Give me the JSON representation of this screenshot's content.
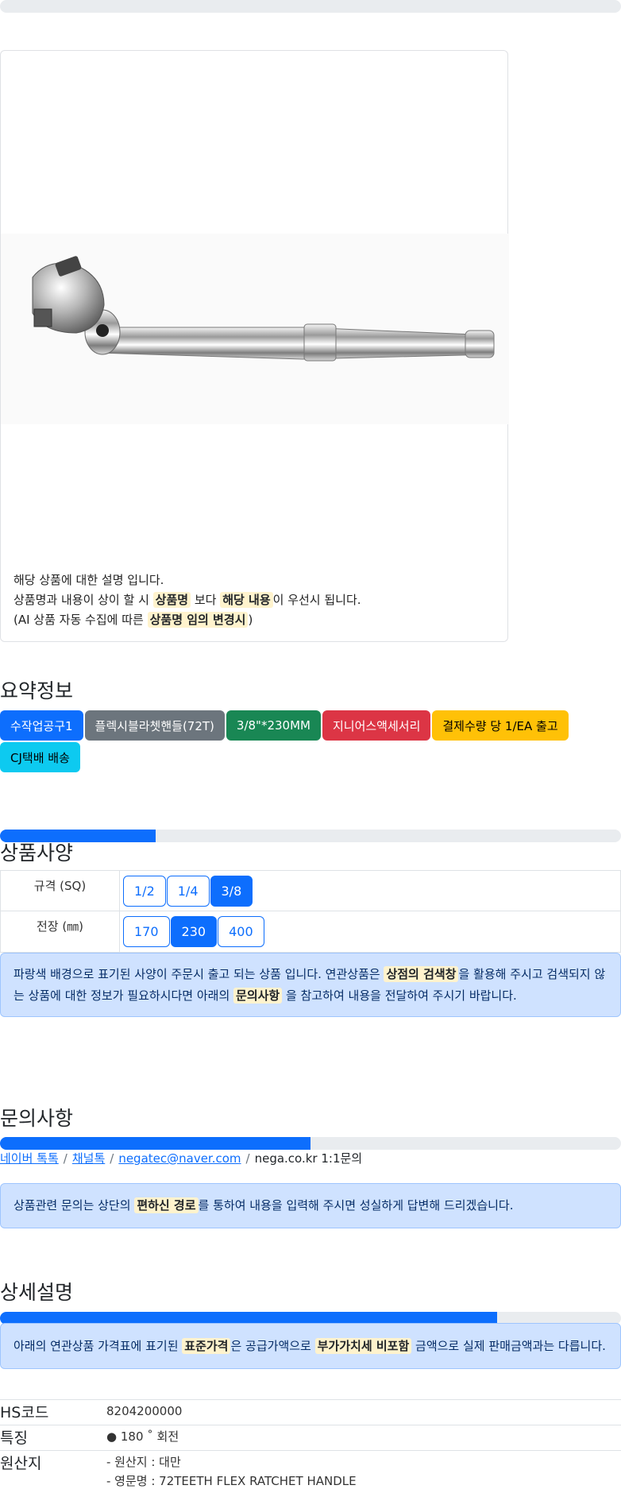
{
  "card": {
    "desc_line1": "해당 상품에 대한 설명 입니다.",
    "desc_line2_a": "상품명과 내용이 상이 할 시 ",
    "desc_line2_mark1": "상품명",
    "desc_line2_b": " 보다 ",
    "desc_line2_mark2": "해당 내용",
    "desc_line2_c": "이 우선시 됩니다.",
    "desc_line3_a": "(AI 상품 자동 수집에 따른 ",
    "desc_line3_mark": "상품명 임의 변경시",
    "desc_line3_b": ")"
  },
  "summary": {
    "title": "요약정보",
    "badges": [
      {
        "label": "수작업공구1",
        "color": "#0d6efd"
      },
      {
        "label": "플렉시블라쳇핸들(72T)",
        "color": "#6c757d"
      },
      {
        "label": "3/8\"*230MM",
        "color": "#198754"
      },
      {
        "label": "지니어스액세서리",
        "color": "#dc3545"
      },
      {
        "label": "결제수량 당 1/EA 출고",
        "color": "#ffc107"
      },
      {
        "label": "CJ택배 배송",
        "color": "#0dcaf0"
      }
    ]
  },
  "spec": {
    "progress": 0.25,
    "title": "상품사양",
    "rows": [
      {
        "label": "규격 (SQ)",
        "options": [
          "1/2",
          "1/4",
          "3/8"
        ],
        "selected": 2
      },
      {
        "label": "전장 (㎜)",
        "options": [
          "170",
          "230",
          "400"
        ],
        "selected": 1
      }
    ],
    "notice_a": "파랑색 배경으로 표기된 사양이 주문시 출고 되는 상품 입니다. 연관상품은 ",
    "notice_mark1": "상점의 검색창",
    "notice_b": "을 활용해 주시고 검색되지 않는 상품에 대한 정보가 필요하시다면 아래의 ",
    "notice_mark2": "문의사항",
    "notice_c": " 을 참고하여 내용을 전달하여 주시기 바랍니다."
  },
  "inquiry": {
    "title": "문의사항",
    "progress": 0.5,
    "links": [
      "네이버 톡톡",
      "채널톡",
      "negatec@naver.com"
    ],
    "plain": "nega.co.kr 1:1문의",
    "separator": "/",
    "notice_a": "상품관련 문의는 상단의 ",
    "notice_mark": "편하신 경로",
    "notice_b": "를 통하여 내용을 입력해 주시면 성실하게 답변해 드리겠습니다."
  },
  "detail": {
    "title": "상세설명",
    "progress": 0.8,
    "notice_a": "아래의 연관상품 가격표에 표기된 ",
    "notice_mark1": "표준가격",
    "notice_b": "은 공급가액으로 ",
    "notice_mark2": "부가가치세 비포함",
    "notice_c": " 금액으로 실제 판매금액과는 다릅니다.",
    "rows": [
      {
        "key": "HS코드",
        "lines": [
          "8204200000"
        ]
      },
      {
        "key": "특징",
        "lines": [
          "● 180 ˚ 회전"
        ]
      },
      {
        "key": "원산지",
        "lines": [
          "- 원산지 : 대만",
          "- 영문명 : 72TEETH FLEX RATCHET HANDLE"
        ]
      }
    ]
  }
}
